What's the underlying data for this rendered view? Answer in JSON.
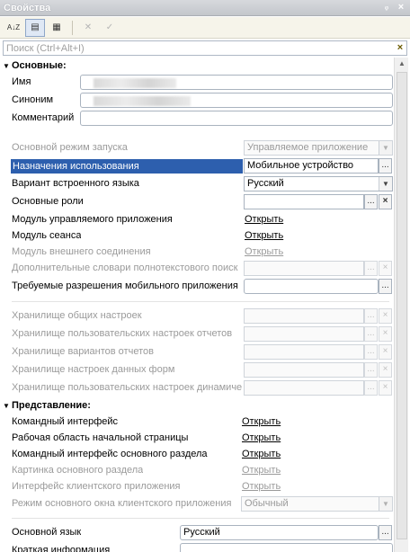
{
  "window": {
    "title": "Свойства",
    "pin_glyph": "ᵩ",
    "close_glyph": "×"
  },
  "toolbar": {
    "sort_glyph": "A↓Z",
    "categories_glyph": "▤",
    "filter_glyph": "▦",
    "delete_glyph": "✕",
    "check_glyph": "✓"
  },
  "search": {
    "placeholder": "Поиск (Ctrl+Alt+I)",
    "value": "",
    "clear_glyph": "×"
  },
  "sections": {
    "main": "Основные:",
    "presentation": "Представление:"
  },
  "props": {
    "name": {
      "label": "Имя"
    },
    "synonym": {
      "label": "Синоним"
    },
    "comment": {
      "label": "Комментарий",
      "value": ""
    },
    "launch_mode": {
      "label": "Основной режим запуска",
      "value": "Управляемое приложение"
    },
    "purposes": {
      "label": "Назначения использования",
      "value": "Мобильное устройство"
    },
    "language_variant": {
      "label": "Вариант встроенного языка",
      "value": "Русский"
    },
    "main_roles": {
      "label": "Основные роли",
      "value": ""
    },
    "managed_module": {
      "label": "Модуль управляемого приложения",
      "link": "Открыть"
    },
    "session_module": {
      "label": "Модуль сеанса",
      "link": "Открыть"
    },
    "external_module": {
      "label": "Модуль внешнего соединения",
      "link": "Открыть"
    },
    "fulltext_dicts": {
      "label": "Дополнительные словари полнотекстового поиск"
    },
    "mobile_permissions": {
      "label": "Требуемые разрешения мобильного приложения"
    },
    "common_settings": {
      "label": "Хранилище общих настроек"
    },
    "report_user_settings": {
      "label": "Хранилище пользовательских настроек отчетов"
    },
    "report_variants": {
      "label": "Хранилище вариантов отчетов"
    },
    "form_data_settings": {
      "label": "Хранилище настроек данных форм"
    },
    "dynamic_list_settings": {
      "label": "Хранилище пользовательских настроек динамиче"
    },
    "command_interface": {
      "label": "Командный интерфейс",
      "link": "Открыть"
    },
    "home_page": {
      "label": "Рабочая область начальной страницы",
      "link": "Открыть"
    },
    "main_section_ci": {
      "label": "Командный интерфейс основного раздела",
      "link": "Открыть"
    },
    "main_section_picture": {
      "label": "Картинка основного раздела",
      "link": "Открыть"
    },
    "client_app_interface": {
      "label": "Интерфейс клиентского приложения",
      "link": "Открыть"
    },
    "client_window_mode": {
      "label": "Режим основного окна клиентского приложения",
      "value": "Обычный"
    },
    "main_language": {
      "label": "Основной язык",
      "value": "Русский"
    },
    "brief_info": {
      "label": "Краткая информация"
    }
  },
  "glyphs": {
    "ellipsis": "...",
    "clear": "×",
    "dropdown": "▼",
    "collapse": "▼"
  }
}
